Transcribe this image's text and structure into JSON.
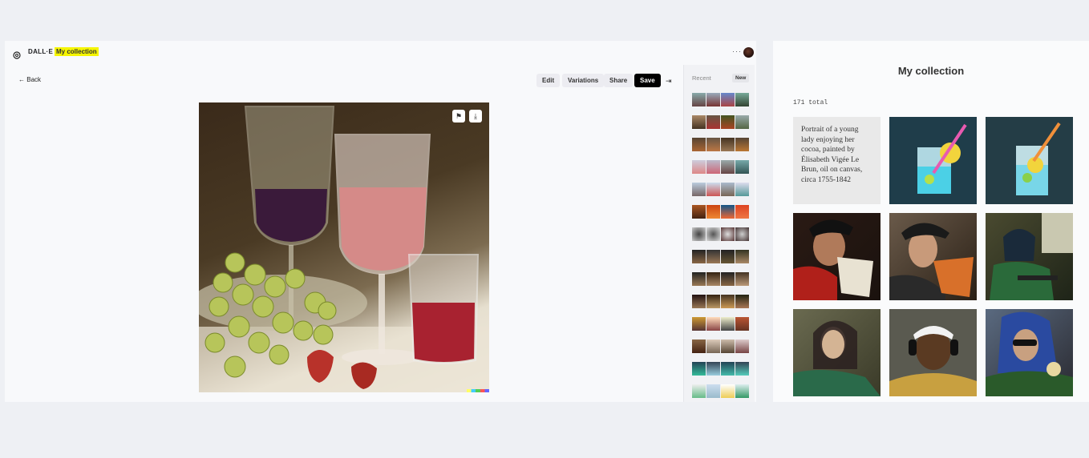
{
  "header": {
    "brand": "DALL·E",
    "crumb": "My collection",
    "more": "···"
  },
  "toolbar": {
    "back": "Back",
    "edit": "Edit",
    "variations": "Variations",
    "share": "Share",
    "save": "Save",
    "collapse": "⇥"
  },
  "history": {
    "label": "Recent",
    "new_label": "New"
  },
  "collection": {
    "title": "My collection",
    "total": "171 total",
    "caption": "Portrait of a young lady enjoying her cocoa, painted by Élisabeth Vigée Le Brun, oil on canvas, circa 1755-1842"
  },
  "colors": {
    "crumb_highlight": "#f5f500",
    "save_bg": "#000000"
  }
}
